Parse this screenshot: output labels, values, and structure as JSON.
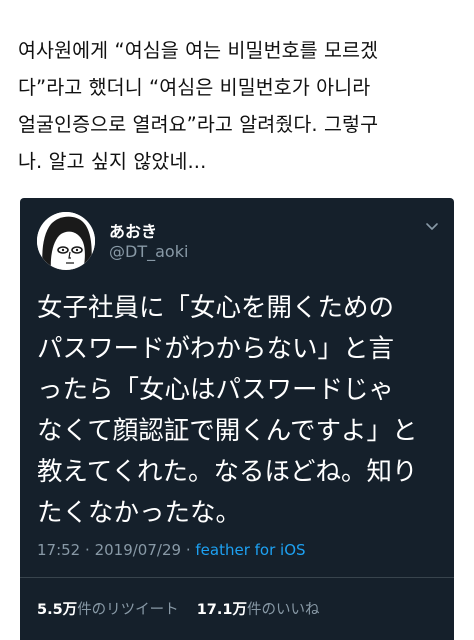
{
  "caption": {
    "lines": [
      "여사원에게 “여심을 여는 비밀번호를 모르겠",
      "다”라고 했더니 “여심은 비밀번호가 아니라",
      "얼굴인증으로 열려요”라고 알려줬다. 그렇구",
      "나. 알고 싶지 않았네..."
    ]
  },
  "tweet": {
    "display_name": "あおき",
    "handle": "@DT_aoki",
    "menu_icon": "chevron-down-icon",
    "avatar_icon": "cartoon-face-avatar",
    "text_lines": [
      "女子社員に「女心を開くための",
      "パスワードがわからない」と言",
      "ったら「女心はパスワードじゃ",
      "なくて顔認証で開くんですよ」と",
      "教えてくれた。なるほどね。知り",
      "たくなかったな。"
    ],
    "time": "17:52",
    "date": "2019/07/29",
    "separator": "·",
    "source": "feather for iOS",
    "retweet_count": "5.5万",
    "retweet_label": "件のリツイート",
    "like_count": "17.1万",
    "like_label": "件のいいね"
  },
  "colors": {
    "card_background": "#15202b",
    "secondary_text": "#8899a6",
    "link": "#1da1f2",
    "divider": "#38444d"
  }
}
